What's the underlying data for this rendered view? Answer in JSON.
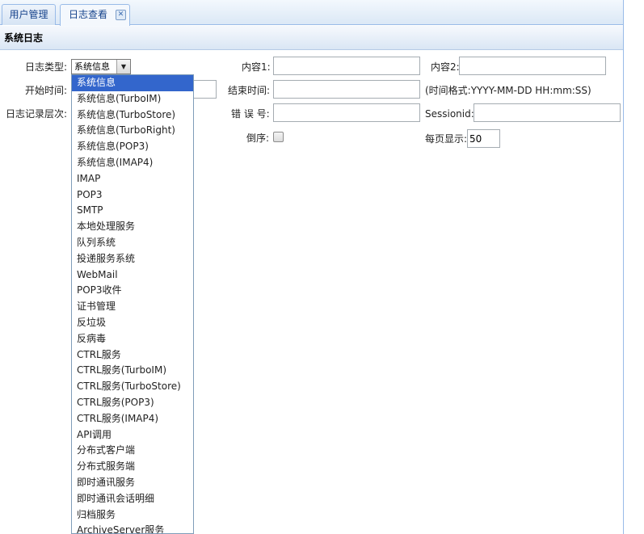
{
  "tabs": [
    {
      "label": "用户管理",
      "active": false
    },
    {
      "label": "日志查看",
      "active": true
    }
  ],
  "panel": {
    "title": "系统日志"
  },
  "form": {
    "log_type_label": "日志类型:",
    "log_type_value": "系统信息",
    "start_time_label": "开始时间:",
    "log_level_label": "日志记录层次:",
    "content1_label": "内容1:",
    "content2_label": "内容2:",
    "end_time_label": "结束时间:",
    "time_format_hint": "(时间格式:YYYY-MM-DD HH:mm:SS)",
    "error_no_label": "错 误 号:",
    "sessionid_label": "Sessionid:",
    "reverse_label": "倒序:",
    "page_size_label": "每页显示:",
    "page_size_value": "50"
  },
  "dropdown": {
    "selected_index": 0,
    "options": [
      "系统信息",
      "系统信息(TurboIM)",
      "系统信息(TurboStore)",
      "系统信息(TurboRight)",
      "系统信息(POP3)",
      "系统信息(IMAP4)",
      "IMAP",
      "POP3",
      "SMTP",
      "本地处理服务",
      "队列系统",
      "投递服务系统",
      "WebMail",
      "POP3收件",
      "证书管理",
      "反垃圾",
      "反病毒",
      "CTRL服务",
      "CTRL服务(TurboIM)",
      "CTRL服务(TurboStore)",
      "CTRL服务(POP3)",
      "CTRL服务(IMAP4)",
      "API调用",
      "分布式客户端",
      "分布式服务端",
      "即时通讯服务",
      "即时通讯会话明细",
      "归档服务",
      "ArchiveServer服务"
    ]
  },
  "icons": {
    "tab_close": "close-icon",
    "select_arrow": "dropdown-arrow-icon"
  }
}
